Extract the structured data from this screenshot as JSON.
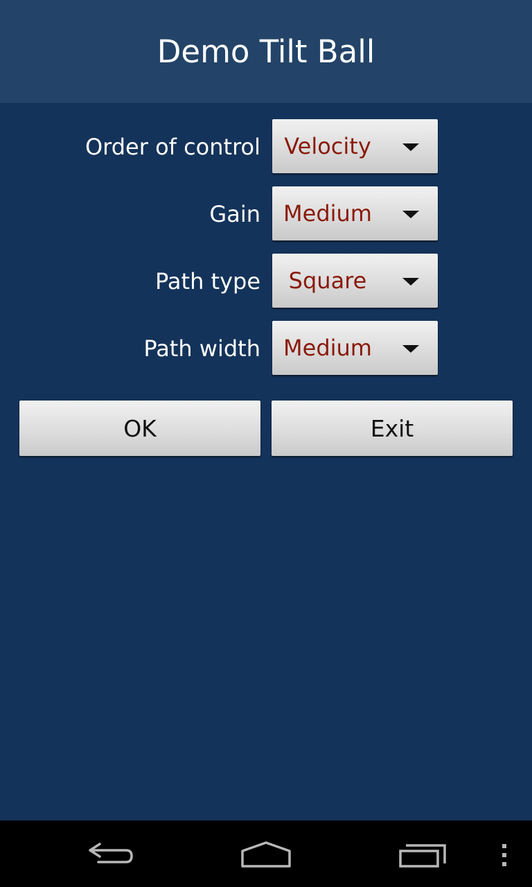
{
  "app": {
    "title": "Demo Tilt Ball"
  },
  "settings": {
    "rows": [
      {
        "label": "Order of control",
        "value": "Velocity"
      },
      {
        "label": "Gain",
        "value": "Medium"
      },
      {
        "label": "Path type",
        "value": "Square"
      },
      {
        "label": "Path width",
        "value": "Medium"
      }
    ]
  },
  "buttons": {
    "ok_label": "OK",
    "exit_label": "Exit"
  },
  "navbar": {
    "icons": [
      "back-icon",
      "home-icon",
      "recent-apps-icon",
      "overflow-menu-icon"
    ]
  },
  "colors": {
    "background": "#14335a",
    "title_bar": "#234468",
    "spinner_value_text": "#8a1a0a",
    "navbar": "#000000"
  }
}
